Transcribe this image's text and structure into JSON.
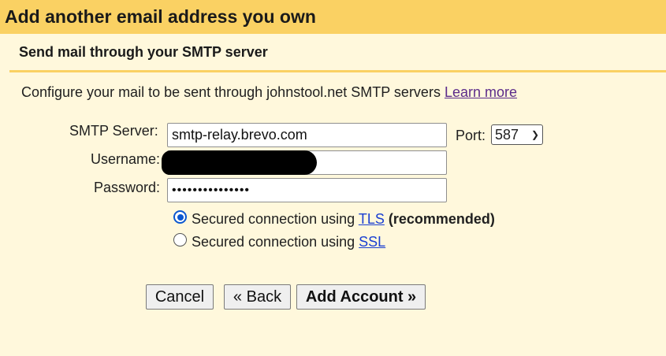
{
  "header": {
    "title": "Add another email address you own",
    "subtitle": "Send mail through your SMTP server"
  },
  "intro": {
    "text": "Configure your mail to be sent through johnstool.net SMTP servers ",
    "learn_more": "Learn more"
  },
  "form": {
    "smtp_server": {
      "label": "SMTP Server:",
      "value": "smtp-relay.brevo.com"
    },
    "port": {
      "label": "Port:",
      "value": "587"
    },
    "username": {
      "label": "Username:",
      "value": ""
    },
    "password": {
      "label": "Password:",
      "value": "•••••••••••••••"
    }
  },
  "security": {
    "tls": {
      "prefix": "Secured connection using ",
      "link": "TLS",
      "suffix": "(recommended)",
      "selected": true
    },
    "ssl": {
      "prefix": "Secured connection using ",
      "link": "SSL",
      "selected": false
    }
  },
  "buttons": {
    "cancel": "Cancel",
    "back": "« Back",
    "add_account": "Add Account »"
  },
  "colors": {
    "title_bar": "#fad163",
    "background": "#fff8dc",
    "radio_selected": "#0b57d0"
  }
}
